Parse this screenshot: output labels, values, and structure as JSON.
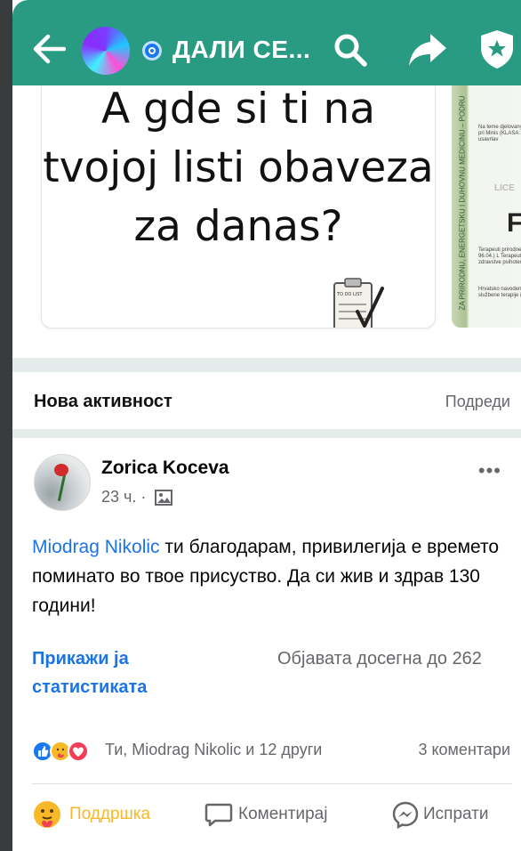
{
  "topbar": {
    "title": "ДАЛИ СЕ...",
    "bg_color": "#2a9b83"
  },
  "carousel": {
    "card1_text": "A gde si ti na tvojoj listi obaveza za danas?",
    "card1_todo_label": "TO DO LIST",
    "card2_vertical_text": "ZA PRIRODNU, ENERGETSKU I DUHOVNU MEDICINU – PODRU",
    "card2_p1": "Na teme djelovany pri Minis (KLASA: usavrlav",
    "card2_lic": "LICE",
    "card2_big": "F",
    "card2_p2": "Terapeuti prirodne 96.04.) L Terapeuti zdravstve psihoter",
    "card2_p3": "Hrvatsko navoden službene terapije i"
  },
  "activity": {
    "title": "Нова активност",
    "sort_label": "Подреди"
  },
  "post": {
    "author": "Zorica Koceva",
    "time": "23 ч. ·",
    "more": "•••",
    "mention": "Miodrag Nikolic",
    "body": " ти благодарам, привилегија е времето поминато во твое присуство. Да си жив и здрав 130 години!",
    "insights_label": "Прикажи ја статистиката",
    "reach_text": "Објавата досегна до 262",
    "reactors_text": "Ти, Miodrag Nikolic и 12 други",
    "comments_count": "3 коментари",
    "actions": {
      "support": "Поддршка",
      "comment": "Коментирај",
      "send": "Испрати"
    },
    "reaction_icons": [
      "like-icon",
      "care-icon",
      "love-icon"
    ],
    "accent_color": "#1b74e4",
    "support_color": "#f7b928"
  }
}
